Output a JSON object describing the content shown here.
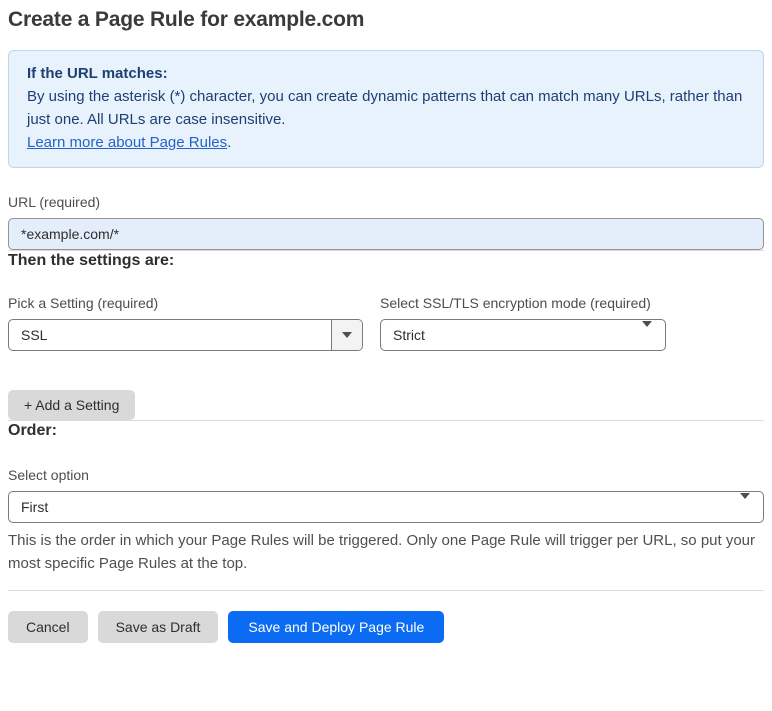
{
  "page": {
    "title": "Create a Page Rule for example.com"
  },
  "info_box": {
    "heading": "If the URL matches:",
    "body": "By using the asterisk (*) character, you can create dynamic patterns that can match many URLs, rather than just one. All URLs are case insensitive.",
    "link_label": "Learn more about Page Rules",
    "link_suffix": "."
  },
  "url_field": {
    "label": "URL (required)",
    "value": "*example.com/*"
  },
  "settings_section": {
    "heading": "Then the settings are:",
    "setting_select": {
      "label": "Pick a Setting (required)",
      "value": "SSL"
    },
    "mode_select": {
      "label": "Select SSL/TLS encryption mode (required)",
      "value": "Strict"
    },
    "add_setting_label": "+ Add a Setting"
  },
  "order_section": {
    "heading": "Order:",
    "select_label": "Select option",
    "value": "First",
    "help_text": "This is the order in which your Page Rules will be triggered. Only one Page Rule will trigger per URL, so put your most specific Page Rules at the top."
  },
  "footer": {
    "cancel_label": "Cancel",
    "save_draft_label": "Save as Draft",
    "save_deploy_label": "Save and Deploy Page Rule"
  },
  "colors": {
    "accent_blue": "#0b6cf3",
    "info_background": "#e8f2fc",
    "info_border": "#b9d7f2",
    "info_text": "#1d3f72",
    "link_blue": "#2563c9",
    "input_autofill_background": "#e4eefb",
    "button_gray": "#d9d9d9"
  }
}
